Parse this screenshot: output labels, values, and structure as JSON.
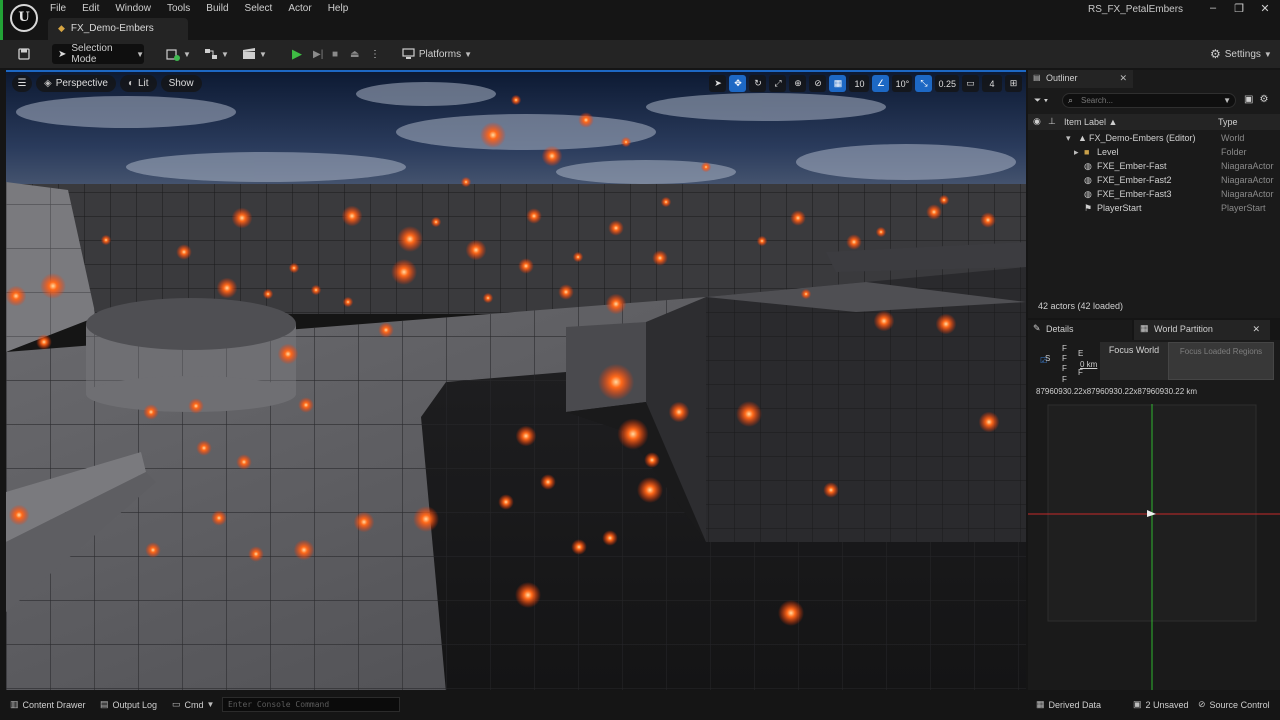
{
  "window": {
    "logo_text": "U",
    "menu": [
      "File",
      "Edit",
      "Window",
      "Tools",
      "Build",
      "Select",
      "Actor",
      "Help"
    ],
    "document_tab": "FX_Demo-Embers",
    "project_name": "RS_FX_PetalEmbers",
    "controls": {
      "minimize": "–",
      "maximize": "❐",
      "close": "✕"
    }
  },
  "toolbar": {
    "mode_label": "Selection Mode",
    "platforms_label": "Platforms",
    "settings_label": "Settings"
  },
  "viewport": {
    "view_label": "Perspective",
    "lit_label": "Lit",
    "show_label": "Show",
    "grid_snap": "10",
    "rotation_snap": "10°",
    "scale_snap": "0.25",
    "camera_speed": "4"
  },
  "outliner": {
    "tab_label": "Outliner",
    "search_placeholder": "Search...",
    "col_label": "Item Label ▲",
    "col_type": "Type",
    "rows": [
      {
        "label": "FX_Demo-Embers (Editor)",
        "type": "World",
        "icon": "world-icon"
      },
      {
        "label": "Level",
        "type": "Folder",
        "icon": "folder-icon"
      },
      {
        "label": "FXE_Ember-Fast",
        "type": "NiagaraActor",
        "icon": "niagara-icon"
      },
      {
        "label": "FXE_Ember-Fast2",
        "type": "NiagaraActor",
        "icon": "niagara-icon"
      },
      {
        "label": "FXE_Ember-Fast3",
        "type": "NiagaraActor",
        "icon": "niagara-icon"
      },
      {
        "label": "PlayerStart",
        "type": "PlayerStart",
        "icon": "player-start-icon"
      }
    ],
    "count": "42 actors (42 loaded)"
  },
  "details": {
    "details_tab": "Details",
    "world_partition_tab": "World Partition",
    "stack_letters": [
      "F",
      "F",
      "E",
      "S",
      "F",
      "F",
      "F"
    ],
    "stack_km": "0 km",
    "focus_world": "Focus World",
    "focus_loaded": "Focus Loaded Regions",
    "world_size": "87960930.22x87960930.22x87960930.22 km"
  },
  "statusbar": {
    "content_drawer": "Content Drawer",
    "output_log": "Output Log",
    "cmd": "Cmd",
    "console_placeholder": "Enter Console Command",
    "derived_data": "Derived Data",
    "unsaved": "2 Unsaved",
    "source_control": "Source Control"
  },
  "colors": {
    "accent": "#1d68c4",
    "play": "#3fbc44",
    "ember": "#ff6a1a"
  }
}
